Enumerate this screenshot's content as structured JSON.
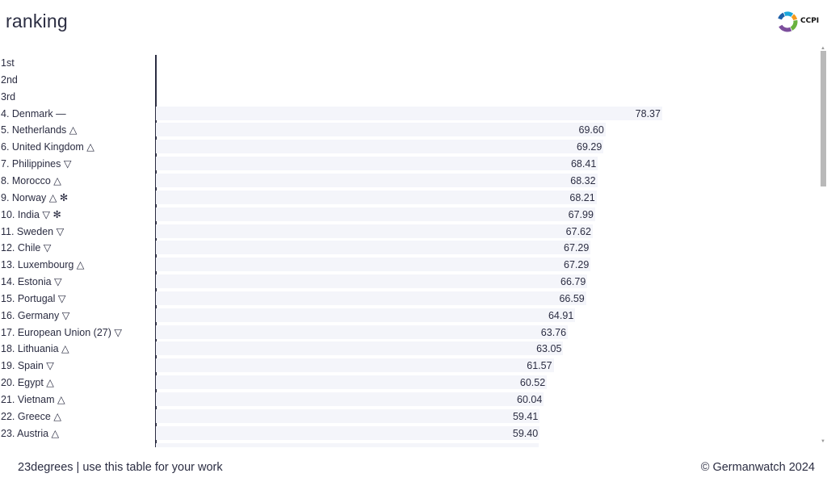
{
  "header": {
    "title": "ranking",
    "logo_text": "CCPI",
    "logo_colors": [
      "#1aa7dc",
      "#1d5fa8",
      "#f39a1e",
      "#6ab23e",
      "#7c4e9c"
    ]
  },
  "colors": {
    "bar": "#f4f5fa",
    "text": "#2b2d42",
    "axis": "#2b2d42"
  },
  "chart_data": {
    "type": "bar",
    "orientation": "horizontal",
    "title": "ranking",
    "xlim": [
      0,
      100
    ],
    "grid": false,
    "categories": [
      "1st",
      "2nd",
      "3rd",
      "4. Denmark —",
      "5. Netherlands △",
      "6. United Kingdom △",
      "7. Philippines ▽",
      "8. Morocco △",
      "9. Norway △ ✻",
      "10. India ▽ ✻",
      "11. Sweden ▽",
      "12. Chile ▽",
      "13. Luxembourg △",
      "14. Estonia ▽",
      "15. Portugal ▽",
      "16. Germany ▽",
      "17. European Union (27) ▽",
      "18. Lithuania △",
      "19. Spain ▽",
      "20. Egypt △",
      "21. Vietnam △",
      "22. Greece △",
      "23. Austria △"
    ],
    "values": [
      null,
      null,
      null,
      78.37,
      69.6,
      69.29,
      68.41,
      68.32,
      68.21,
      67.99,
      67.62,
      67.29,
      67.29,
      66.79,
      66.59,
      64.91,
      63.76,
      63.05,
      61.57,
      60.52,
      60.04,
      59.41,
      59.4
    ],
    "value_labels": [
      "",
      "",
      "",
      "78.37",
      "69.60",
      "69.29",
      "68.41",
      "68.32",
      "68.21",
      "67.99",
      "67.62",
      "67.29",
      "67.29",
      "66.79",
      "66.59",
      "64.91",
      "63.76",
      "63.05",
      "61.57",
      "60.52",
      "60.04",
      "59.41",
      "59.40"
    ]
  },
  "footer": {
    "left": "23degrees | use this table for your work",
    "right": "© Germanwatch 2024"
  },
  "scrollbar": {
    "up_arrow": "▲",
    "down_arrow": "▼"
  }
}
